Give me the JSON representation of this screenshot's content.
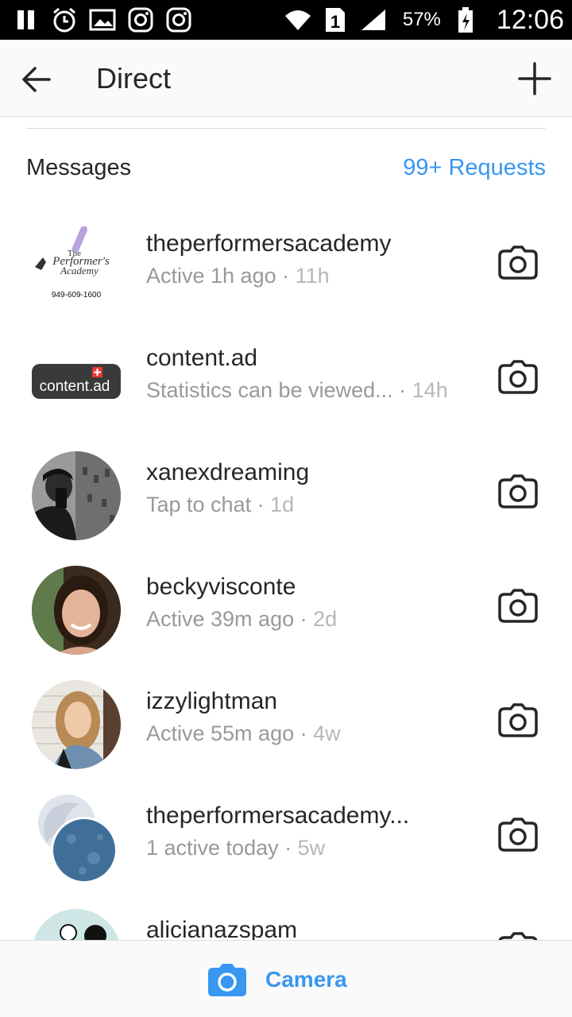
{
  "status_bar": {
    "battery_percent": "57%",
    "time": "12:06",
    "sim_slot": "1",
    "icons_left": [
      "pause-icon",
      "alarm-icon",
      "gallery-icon",
      "instagram-icon",
      "instagram-icon"
    ],
    "icons_right": [
      "wifi-icon",
      "sim-icon",
      "signal-icon",
      "battery-icon"
    ]
  },
  "header": {
    "title": "Direct",
    "back_icon": "back-arrow-icon",
    "new_icon": "plus-icon"
  },
  "section": {
    "title": "Messages",
    "requests_label": "99+ Requests"
  },
  "threads": [
    {
      "username": "theperformersacademy",
      "status": "Active 1h ago",
      "time": "11h",
      "logo_lines": [
        "The",
        "Performer's",
        "Academy",
        "949-609-1600"
      ]
    },
    {
      "username": "content.ad",
      "status": "Statistics can be viewed...",
      "time": "14h",
      "logo_text": "content.ad"
    },
    {
      "username": "xanexdreaming",
      "status": "Tap to chat",
      "time": "1d"
    },
    {
      "username": "beckyvisconte",
      "status": "Active 39m ago",
      "time": "2d"
    },
    {
      "username": "izzylightman",
      "status": "Active 55m ago",
      "time": "4w"
    },
    {
      "username": "theperformersacademy...",
      "status": "1 active today",
      "time": "5w"
    },
    {
      "username": "alicianazspam",
      "status": "",
      "time": ""
    }
  ],
  "bottom_bar": {
    "camera_label": "Camera"
  },
  "colors": {
    "accent_blue": "#3897f0",
    "text_primary": "#262626",
    "text_secondary": "#999999"
  }
}
